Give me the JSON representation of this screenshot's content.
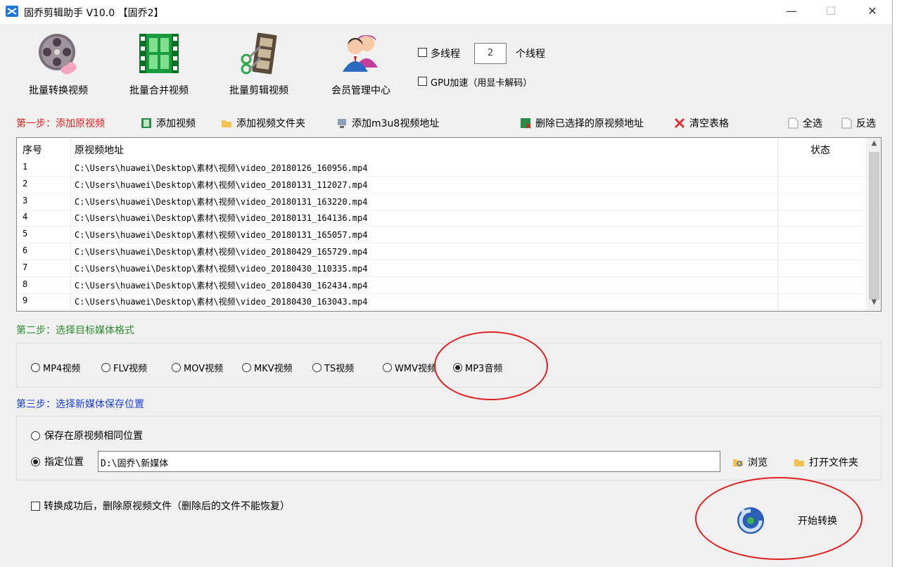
{
  "window": {
    "title": "固乔剪辑助手 V10.0 【固乔2】",
    "minimize": "—",
    "maximize": "☐",
    "close": "✕"
  },
  "toolbar": {
    "batch_convert": "批量转换视频",
    "batch_merge": "批量合并视频",
    "batch_edit": "批量剪辑视频",
    "member_center": "会员管理中心",
    "multithread_label": "多线程",
    "thread_count": "2",
    "thread_unit": "个线程",
    "gpu_label": "GPU加速（用显卡解码）"
  },
  "step1": {
    "label": "第一步：添加原视频",
    "add_video": "添加视频",
    "add_folder": "添加视频文件夹",
    "add_m3u8": "添加m3u8视频地址",
    "delete_selected": "删除已选择的原视频地址",
    "clear_table": "清空表格",
    "select_all": "全选",
    "invert": "反选"
  },
  "table": {
    "columns": [
      "序号",
      "原视频地址",
      "状态"
    ],
    "rows": [
      {
        "idx": "1",
        "path": "C:\\Users\\huawei\\Desktop\\素材\\视频\\video_20180126_160956.mp4",
        "status": ""
      },
      {
        "idx": "2",
        "path": "C:\\Users\\huawei\\Desktop\\素材\\视频\\video_20180131_112027.mp4",
        "status": ""
      },
      {
        "idx": "3",
        "path": "C:\\Users\\huawei\\Desktop\\素材\\视频\\video_20180131_163220.mp4",
        "status": ""
      },
      {
        "idx": "4",
        "path": "C:\\Users\\huawei\\Desktop\\素材\\视频\\video_20180131_164136.mp4",
        "status": ""
      },
      {
        "idx": "5",
        "path": "C:\\Users\\huawei\\Desktop\\素材\\视频\\video_20180131_165057.mp4",
        "status": ""
      },
      {
        "idx": "6",
        "path": "C:\\Users\\huawei\\Desktop\\素材\\视频\\video_20180429_165729.mp4",
        "status": ""
      },
      {
        "idx": "7",
        "path": "C:\\Users\\huawei\\Desktop\\素材\\视频\\video_20180430_110335.mp4",
        "status": ""
      },
      {
        "idx": "8",
        "path": "C:\\Users\\huawei\\Desktop\\素材\\视频\\video_20180430_162434.mp4",
        "status": ""
      },
      {
        "idx": "9",
        "path": "C:\\Users\\huawei\\Desktop\\素材\\视频\\video_20180430_163043.mp4",
        "status": ""
      }
    ]
  },
  "step2": {
    "label": "第二步：选择目标媒体格式",
    "formats": [
      "MP4视频",
      "FLV视频",
      "MOV视频",
      "MKV视频",
      "TS视频",
      "WMV视频",
      "MP3音频"
    ],
    "selected": "MP3音频"
  },
  "step3": {
    "label": "第三步：选择新媒体保存位置",
    "option_same": "保存在原视频相同位置",
    "option_custom": "指定位置",
    "custom_path": "D:\\固乔\\新媒体",
    "browse": "浏览",
    "open_folder": "打开文件夹"
  },
  "footer": {
    "delete_after": "转换成功后，删除原视频文件（删除后的文件不能恢复）",
    "start": "开始转换"
  },
  "colors": {
    "step1": "#e02020",
    "step2": "#2e8b2e",
    "step3": "#1a3fd8",
    "annotation": "#e02020"
  }
}
